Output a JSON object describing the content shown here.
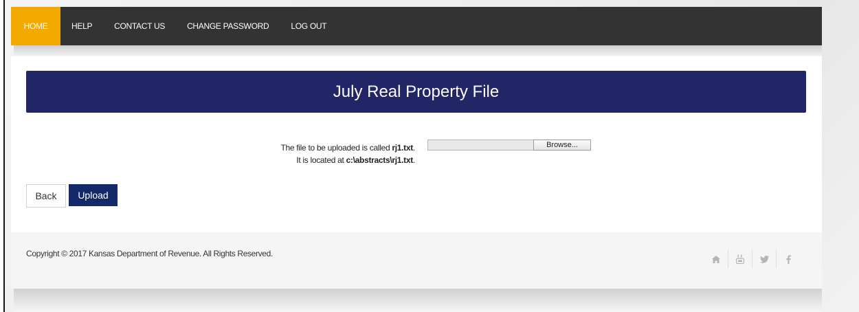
{
  "nav": {
    "items": [
      {
        "label": "HOME",
        "active": true
      },
      {
        "label": "HELP",
        "active": false
      },
      {
        "label": "CONTACT US",
        "active": false
      },
      {
        "label": "CHANGE PASSWORD",
        "active": false
      },
      {
        "label": "LOG OUT",
        "active": false
      }
    ]
  },
  "page": {
    "title": "July Real Property File"
  },
  "info": {
    "line1_prefix": "The file to be uploaded is called ",
    "line1_file": "rj1.txt",
    "line1_suffix": ".",
    "line2_prefix": "It is located at ",
    "line2_path": "c:\\abstracts\\rj1.txt",
    "line2_suffix": "."
  },
  "file_input": {
    "value": "",
    "browse_label": "Browse..."
  },
  "actions": {
    "back_label": "Back",
    "upload_label": "Upload"
  },
  "footer": {
    "copyright": "Copyright © 2017 Kansas Department of Revenue. All Rights Reserved.",
    "social_icons": [
      "home-icon",
      "youtube-icon",
      "twitter-icon",
      "facebook-icon"
    ]
  },
  "colors": {
    "nav_bg": "#333333",
    "nav_active": "#f2a900",
    "banner": "#222566",
    "upload_button": "#14296a"
  }
}
